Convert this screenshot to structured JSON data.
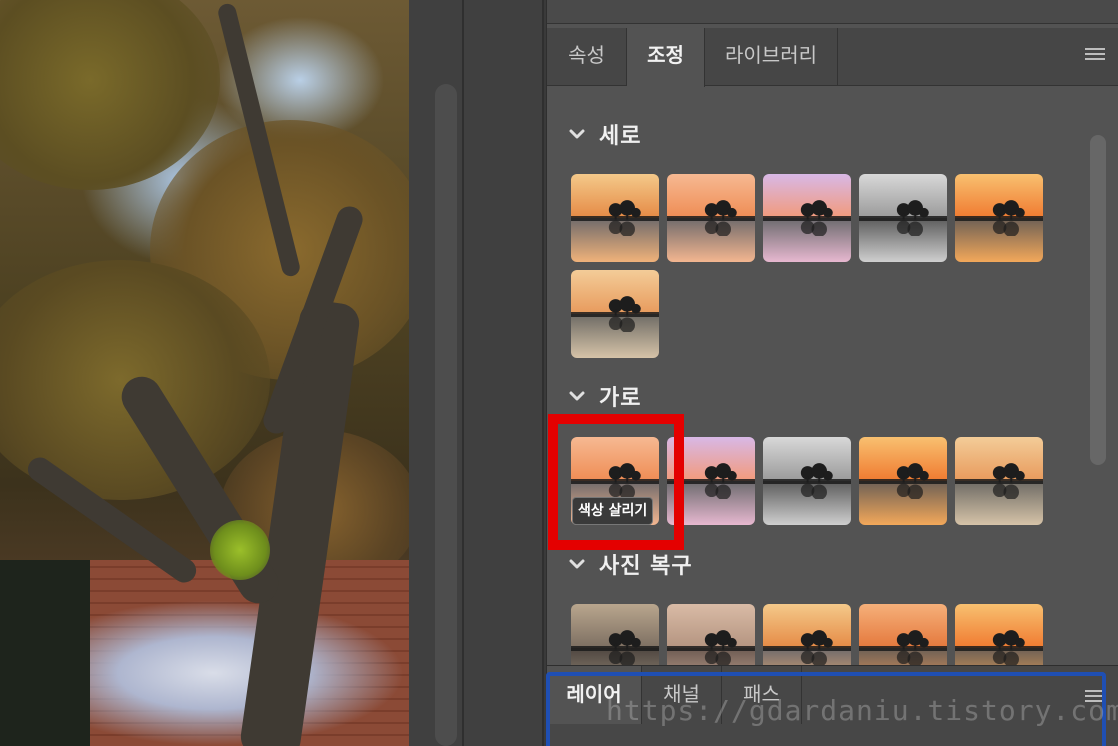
{
  "properties_panel": {
    "tabs": [
      {
        "label": "속성",
        "active": false
      },
      {
        "label": "조정",
        "active": true
      },
      {
        "label": "라이브러리",
        "active": false
      }
    ],
    "menu_icon": "hamburger-menu-icon"
  },
  "adjustments": {
    "sections": [
      {
        "title": "세로",
        "expanded": true,
        "presets": 6
      },
      {
        "title": "가로",
        "expanded": true,
        "presets": 5
      },
      {
        "title": "사진 복구",
        "expanded": true,
        "presets": 5
      }
    ],
    "hovered_preset_tooltip": "색상 살리기",
    "highlight_color": "#e40000"
  },
  "layers_panel": {
    "tabs": [
      {
        "label": "레이어",
        "active": true
      },
      {
        "label": "채널",
        "active": false
      },
      {
        "label": "패스",
        "active": false
      }
    ],
    "menu_icon": "hamburger-menu-icon"
  },
  "watermark": "https://gdardaniu.tistory.com/"
}
